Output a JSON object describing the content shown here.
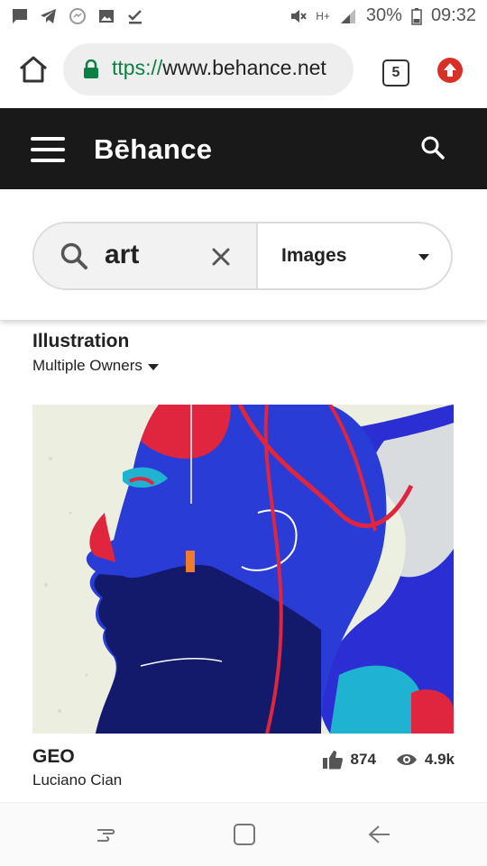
{
  "status_bar": {
    "battery": "30%",
    "time": "09:32",
    "network": "H+"
  },
  "browser": {
    "url_scheme": "ttps://",
    "url_host": "www.behance.net",
    "tab_count": "5"
  },
  "header": {
    "logo": "Bēhance"
  },
  "search": {
    "query": "art",
    "type": "Images"
  },
  "previous_project": {
    "title": "Illustration",
    "owners": "Multiple Owners"
  },
  "project": {
    "title": "GEO",
    "author": "Luciano Cian",
    "appreciations": "874",
    "views": "4.9k"
  },
  "colors": {
    "header_bg": "#191919",
    "url_green": "#0b8043",
    "art_blue": "#2a3cd6",
    "art_red": "#e0263e"
  }
}
